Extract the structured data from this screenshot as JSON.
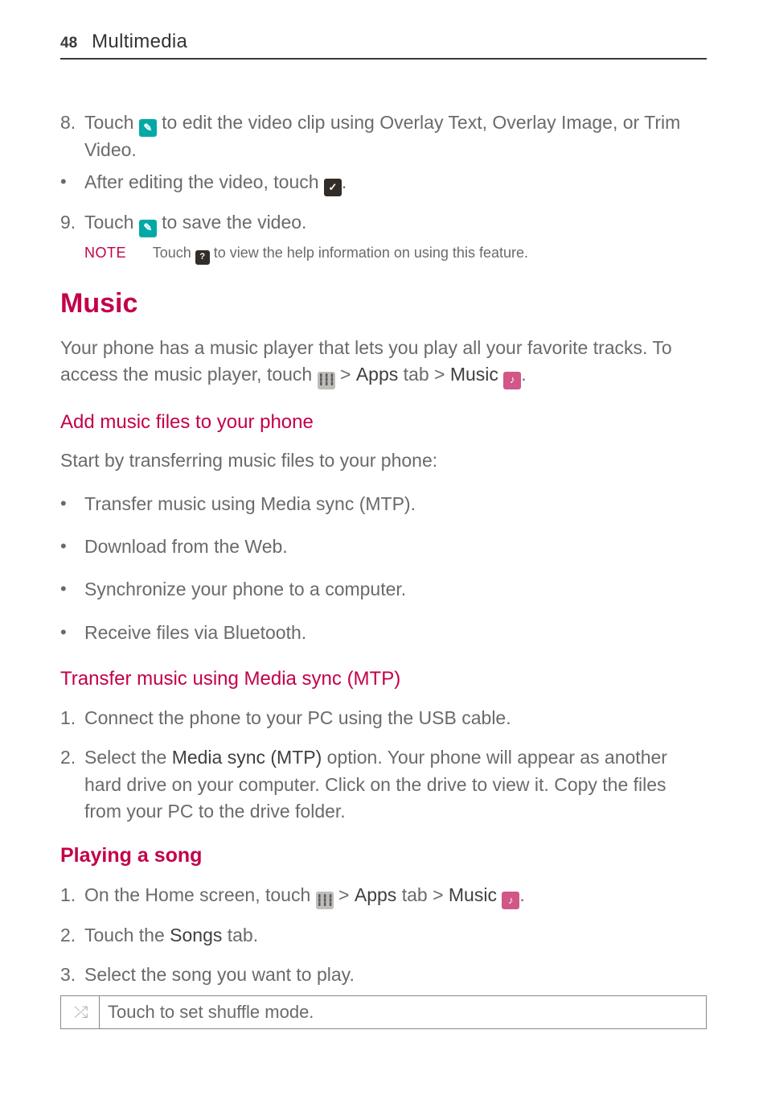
{
  "page": {
    "number": "48",
    "section": "Multimedia"
  },
  "step8": {
    "marker": "8.",
    "t1": "Touch ",
    "icon": "✎",
    "t2": " to edit the video clip using Overlay Text, Overlay Image, or Trim Video."
  },
  "afterEdit": {
    "t1": "After editing the video, touch ",
    "icon": "✓",
    "t2": "."
  },
  "step9": {
    "marker": "9.",
    "t1": "Touch ",
    "icon": "✎",
    "t2": " to save the video."
  },
  "note": {
    "label": "NOTE",
    "t1": "Touch ",
    "icon": "?",
    "t2": " to view the help information on using this feature."
  },
  "music": {
    "heading": "Music",
    "intro1": "Your phone has a music player that lets you play all your favorite tracks. To access the music player, touch ",
    "gridIcon": "┇┇┇",
    "gt": " > ",
    "apps": "Apps",
    "tab": " tab > ",
    "musicWord": "Music",
    "musicIcon": "♪",
    "dot": "."
  },
  "addFiles": {
    "heading": "Add music files to your phone",
    "intro": "Start by transferring music files to your phone:",
    "b1": "Transfer music using Media sync (MTP).",
    "b2": "Download from the Web.",
    "b3": "Synchronize your phone to a computer.",
    "b4": "Receive files via Bluetooth."
  },
  "transfer": {
    "heading": "Transfer music using Media sync (MTP)",
    "s1": {
      "marker": "1.",
      "text": "Connect the phone to your PC using the USB cable."
    },
    "s2": {
      "marker": "2.",
      "t1": "Select the ",
      "bold": "Media sync (MTP)",
      "t2": " option. Your phone will appear as another hard drive on your computer. Click on the drive to view it. Copy the files from your PC to the drive folder."
    }
  },
  "playing": {
    "heading": "Playing a song",
    "s1": {
      "marker": "1.",
      "t1": "On the Home screen, touch ",
      "gridIcon": "┇┇┇",
      "gt": " > ",
      "apps": "Apps",
      "tab": " tab > ",
      "musicWord": "Music",
      "musicIcon": "♪",
      "dot": "."
    },
    "s2": {
      "marker": "2.",
      "t1": "Touch the ",
      "bold": "Songs",
      "t2": " tab."
    },
    "s3": {
      "marker": "3.",
      "text": "Select the song you want to play."
    }
  },
  "table": {
    "shuffleIcon": "⤮",
    "shuffleText": "Touch to set shuffle mode."
  }
}
